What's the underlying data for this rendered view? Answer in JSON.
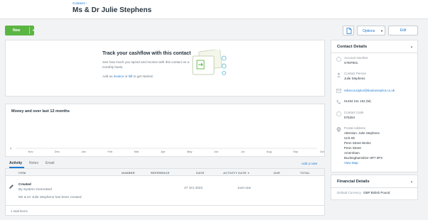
{
  "breadcrumb": "Contacts ›",
  "contact_name": "Ms & Dr Julie Stephens",
  "toolbar": {
    "new_label": "New",
    "options_label": "Options",
    "edit_label": "Edit"
  },
  "cashflow": {
    "title": "Track your cashflow with this contact",
    "description": "See how much you spend and receive with this contact on a monthly basis.",
    "link_prefix": "Add an",
    "link_invoice": "invoice",
    "link_or": "or",
    "link_bill": "bill",
    "link_suffix": "to get started."
  },
  "money": {
    "title": "Money and over last 12 months"
  },
  "chart_data": {
    "type": "bar",
    "categories": [
      "Nov",
      "Dec",
      "Jan",
      "Feb",
      "Mar",
      "Apr",
      "May",
      "Jun",
      "Jul",
      "Aug",
      "Sep",
      "Oct"
    ],
    "values": [
      0,
      0,
      0,
      0,
      0,
      0,
      0,
      0,
      0,
      0,
      0,
      0
    ],
    "ytick_labels": [
      "0"
    ],
    "ylim": [
      0,
      1
    ]
  },
  "tabs": [
    {
      "label": "Activity",
      "active": true
    },
    {
      "label": "Notes",
      "active": false
    },
    {
      "label": "Email",
      "active": false
    }
  ],
  "add_note": "Add a note",
  "activity_table": {
    "headers": {
      "item": "ITEM",
      "number": "NUMBER",
      "reference": "REFERENCE",
      "date": "DATE",
      "activity_date": "ACTIVITY DATE",
      "sort_indicator": "▼",
      "due": "DUE",
      "total": "TOTAL"
    },
    "rows": [
      {
        "title": "Created",
        "subtitle": "By System Generated",
        "description": "Ms & Dr Julie Stephens has been created",
        "date": "27 Oct 2022",
        "activity_date": "Just now"
      }
    ],
    "footer": "1 total items"
  },
  "contact_details": {
    "title": "Contact Details",
    "account_number_label": "Account Number",
    "account_number": "STEP001",
    "contact_person_label": "Contact Person",
    "contact_person": "Julie  Stephens",
    "email": "rebecca.taylor@businessp!lot.co.uk",
    "phone": "01494 211 152 (M)",
    "contact_code_label": "Contact Code",
    "contact_code": "575264",
    "postal_address_label": "Postal Address",
    "address_lines": [
      "Attention: Julie Stephens",
      "Unit 4D",
      "Penn Street Works",
      "Penn Street",
      "Amersham",
      "Buckinghamshire HP7 0PX"
    ],
    "view_map": "View Map"
  },
  "financial_details": {
    "title": "Financial Details",
    "currency_label": "Default Currency",
    "currency": "GBP British Pound"
  },
  "colors": {
    "accent": "#1f7ad2",
    "new_button": "#5bb543"
  }
}
